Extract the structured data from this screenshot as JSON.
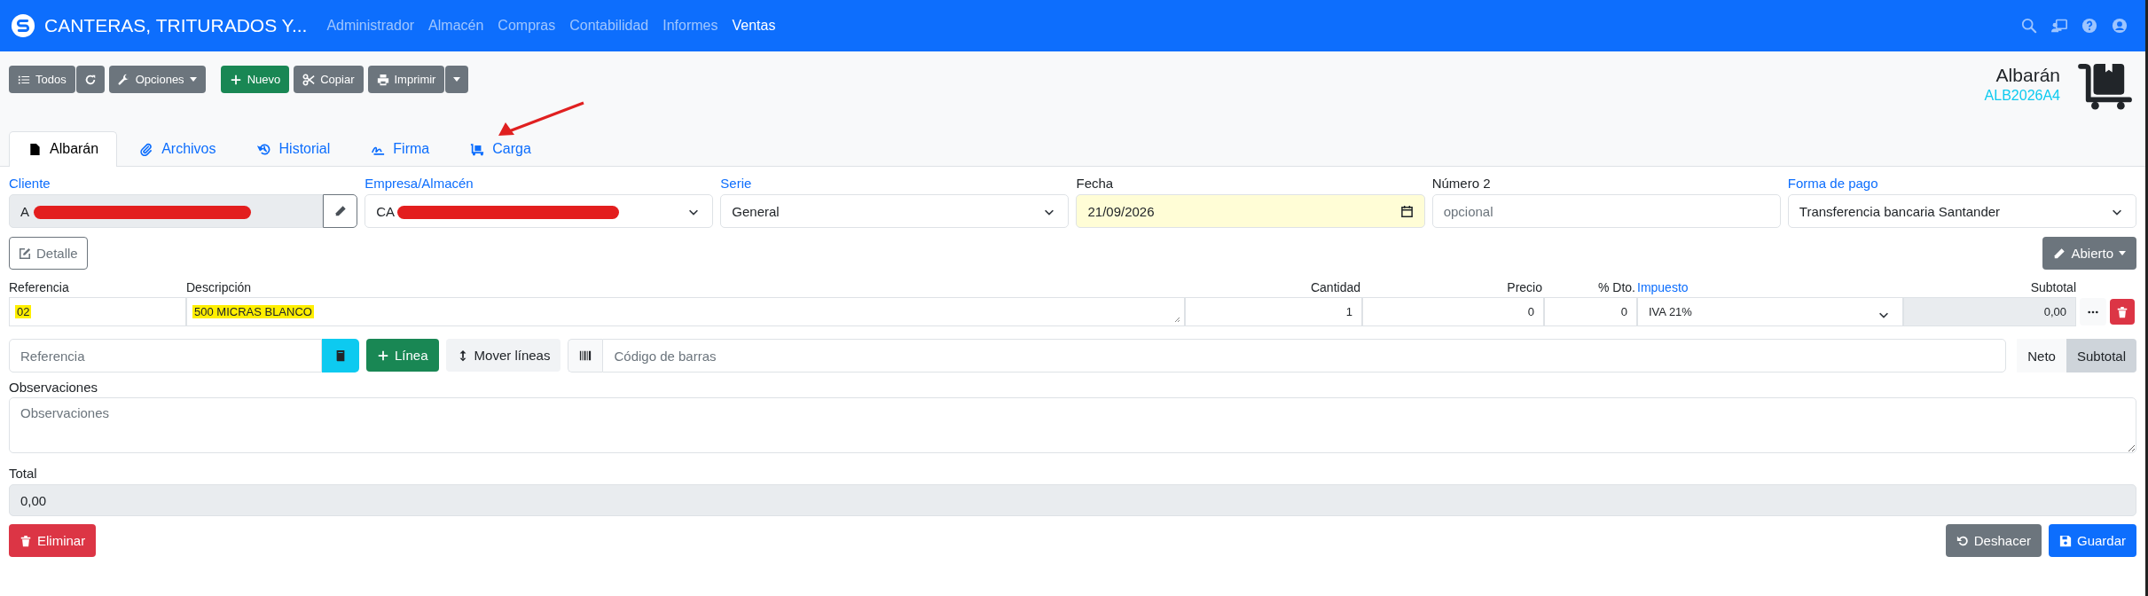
{
  "navbar": {
    "title": "CANTERAS, TRITURADOS Y...",
    "menu": [
      {
        "label": "Administrador",
        "selected": false
      },
      {
        "label": "Almacén",
        "selected": false
      },
      {
        "label": "Compras",
        "selected": false
      },
      {
        "label": "Contabilidad",
        "selected": false
      },
      {
        "label": "Informes",
        "selected": false
      },
      {
        "label": "Ventas",
        "selected": true
      }
    ]
  },
  "toolbar": {
    "todos": "Todos",
    "opciones": "Opciones",
    "nuevo": "Nuevo",
    "copiar": "Copiar",
    "imprimir": "Imprimir"
  },
  "header": {
    "title": "Albarán",
    "code": "ALB2026A4"
  },
  "tabs": [
    {
      "label": "Albarán",
      "selected": true
    },
    {
      "label": "Archivos",
      "selected": false
    },
    {
      "label": "Historial",
      "selected": false
    },
    {
      "label": "Firma",
      "selected": false
    },
    {
      "label": "Carga",
      "selected": false
    }
  ],
  "fields": [
    {
      "label": "Cliente",
      "link": true,
      "kind": "lookup",
      "value": "A",
      "redacted": true
    },
    {
      "label": "Empresa/Almacén",
      "link": true,
      "kind": "select",
      "value": "CA",
      "redacted": true
    },
    {
      "label": "Serie",
      "link": true,
      "kind": "select",
      "value": "General",
      "redacted": false
    },
    {
      "label": "Fecha",
      "link": false,
      "kind": "date",
      "value": "21/09/2026",
      "redacted": false
    },
    {
      "label": "Número 2",
      "link": false,
      "kind": "text",
      "placeholder": "opcional",
      "redacted": false
    },
    {
      "label": "Forma de pago",
      "link": true,
      "kind": "select",
      "value": "Transferencia bancaria Santander",
      "redacted": false
    }
  ],
  "detail_button": "Detalle",
  "status_button": "Abierto",
  "lines": {
    "columns": [
      {
        "label": "Referencia",
        "link": false
      },
      {
        "label": "Descripción",
        "link": false
      },
      {
        "label": "Cantidad",
        "link": false
      },
      {
        "label": "Precio",
        "link": false
      },
      {
        "label": "% Dto.",
        "link": false
      },
      {
        "label": "Impuesto",
        "link": true
      },
      {
        "label": "Subtotal",
        "link": false
      }
    ],
    "rows": [
      {
        "reference": "02",
        "description": "500 MICRAS BLANCO",
        "quantity": "1",
        "price": "0",
        "discount": "0",
        "tax": "IVA 21%",
        "subtotal": "0,00",
        "highlighted": true
      }
    ]
  },
  "add_line": {
    "reference_placeholder": "Referencia",
    "add_button": "Línea",
    "move_button": "Mover líneas",
    "barcode_placeholder": "Código de barras",
    "modes": [
      {
        "label": "Neto",
        "selected": false
      },
      {
        "label": "Subtotal",
        "selected": true
      }
    ]
  },
  "observations": {
    "label": "Observaciones",
    "placeholder": "Observaciones"
  },
  "total": {
    "label": "Total",
    "value": "0,00"
  },
  "footer": {
    "delete": "Eliminar",
    "undo": "Deshacer",
    "save": "Guardar"
  }
}
